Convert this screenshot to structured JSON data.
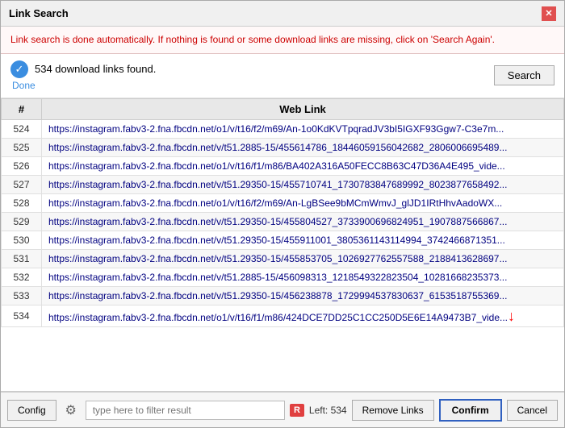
{
  "dialog": {
    "title": "Link Search",
    "close_label": "✕"
  },
  "info_bar": {
    "message": "Link search is done automatically. If nothing is found or some download links are missing, click on 'Search Again'."
  },
  "status": {
    "links_found": "534 download links found.",
    "done_label": "Done",
    "search_button_label": "Search"
  },
  "table": {
    "headers": [
      "#",
      "Web Link"
    ],
    "rows": [
      {
        "num": "524",
        "url": "https://instagram.fabv3-2.fna.fbcdn.net/o1/v/t16/f2/m69/An-1o0KdKVTpqradJV3bI5IGXF93Ggw7-C3e7m..."
      },
      {
        "num": "525",
        "url": "https://instagram.fabv3-2.fna.fbcdn.net/v/t51.2885-15/455614786_18446059156042682_2806006695489..."
      },
      {
        "num": "526",
        "url": "https://instagram.fabv3-2.fna.fbcdn.net/o1/v/t16/f1/m86/BA402A316A50FECC8B63C47D36A4E495_vide..."
      },
      {
        "num": "527",
        "url": "https://instagram.fabv3-2.fna.fbcdn.net/v/t51.29350-15/455710741_1730783847689992_8023877658492..."
      },
      {
        "num": "528",
        "url": "https://instagram.fabv3-2.fna.fbcdn.net/o1/v/t16/f2/m69/An-LgBSee9bMCmWmvJ_glJD1IRtHhvAadoWX..."
      },
      {
        "num": "529",
        "url": "https://instagram.fabv3-2.fna.fbcdn.net/v/t51.29350-15/455804527_3733900696824951_1907887566867..."
      },
      {
        "num": "530",
        "url": "https://instagram.fabv3-2.fna.fbcdn.net/v/t51.29350-15/455911001_3805361143114994_3742466871351..."
      },
      {
        "num": "531",
        "url": "https://instagram.fabv3-2.fna.fbcdn.net/v/t51.29350-15/455853705_1026927762557588_2188413628697..."
      },
      {
        "num": "532",
        "url": "https://instagram.fabv3-2.fna.fbcdn.net/v/t51.2885-15/456098313_1218549322823504_10281668235373..."
      },
      {
        "num": "533",
        "url": "https://instagram.fabv3-2.fna.fbcdn.net/v/t51.29350-15/456238878_1729994537830637_6153518755369..."
      },
      {
        "num": "534",
        "url": "https://instagram.fabv3-2.fna.fbcdn.net/o1/v/t16/f1/m86/424DCE7DD25C1CC250D5E6E14A9473B7_vide..."
      }
    ],
    "last_row_has_arrow": true
  },
  "bottom_bar": {
    "config_label": "Config",
    "filter_placeholder": "type here to filter result",
    "left_count": "Left: 534",
    "remove_links_label": "Remove Links",
    "confirm_label": "Confirm",
    "cancel_label": "Cancel"
  }
}
